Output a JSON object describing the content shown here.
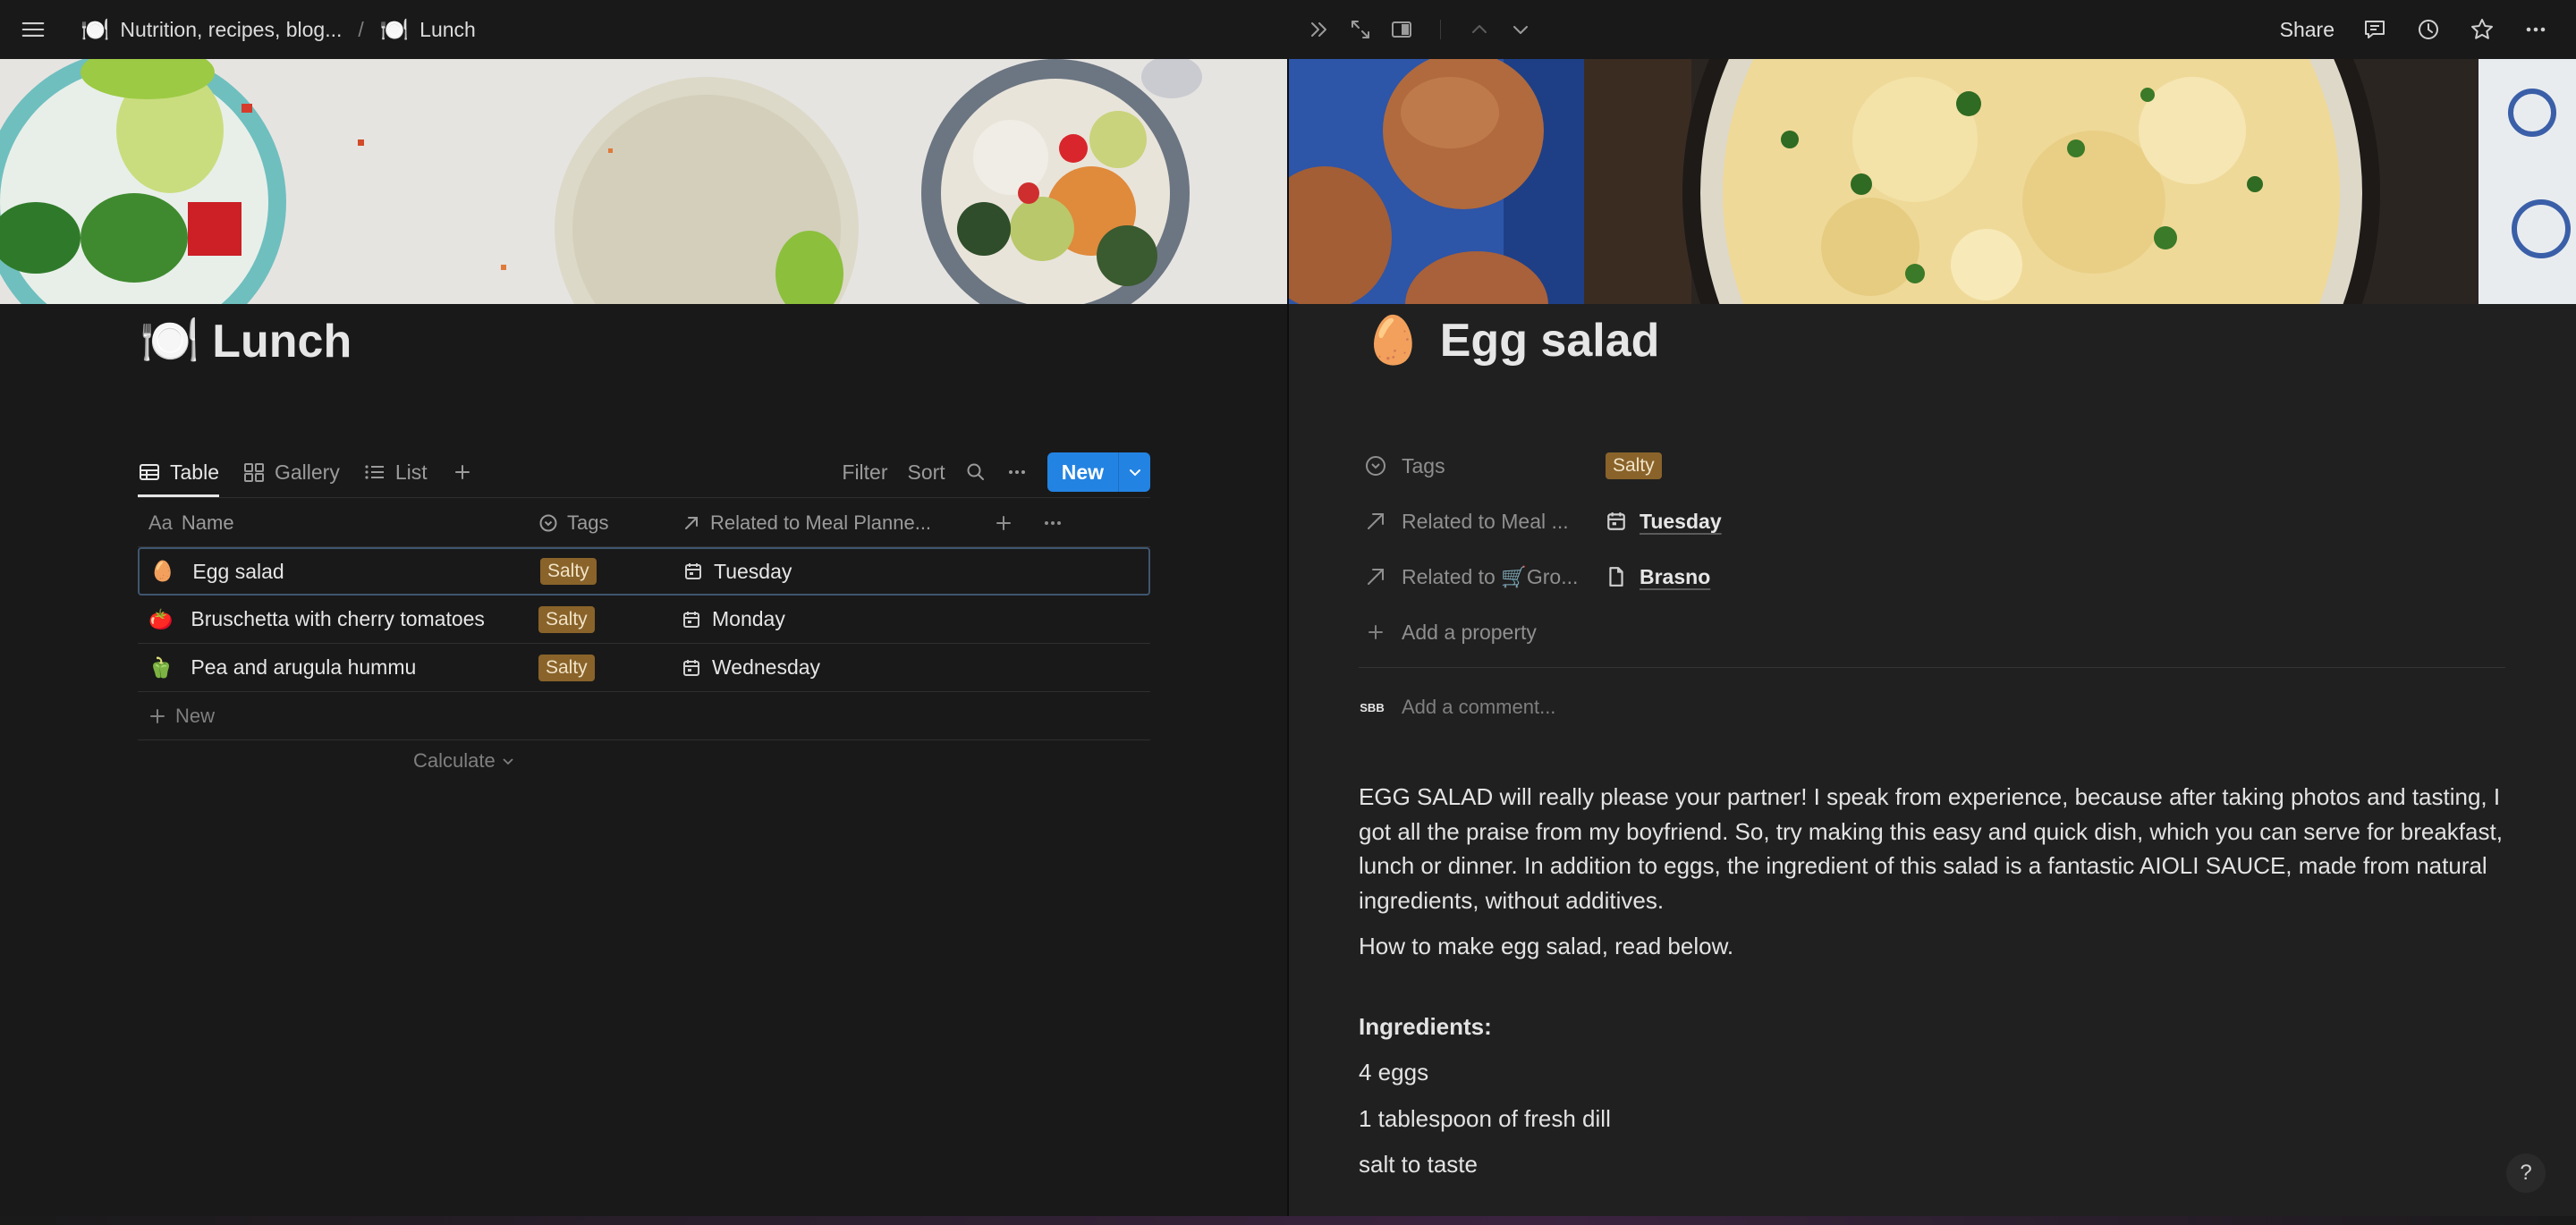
{
  "topbar": {
    "breadcrumb_parent": "Nutrition, recipes, blog...",
    "breadcrumb_current": "Lunch",
    "breadcrumb_parent_emoji": "🍽️",
    "breadcrumb_current_emoji": "🍽️",
    "separator": "/",
    "share_label": "Share",
    "icons": [
      "menu-icon",
      "collapse-panel-icon",
      "expand-icon",
      "side-peek-icon",
      "chevron-up-icon",
      "chevron-down-icon",
      "comments-icon",
      "history-icon",
      "star-icon",
      "more-icon"
    ]
  },
  "left": {
    "title_emoji": "🍽️",
    "title": "Lunch",
    "tabs": [
      {
        "label": "Table",
        "icon": "table-icon"
      },
      {
        "label": "Gallery",
        "icon": "gallery-icon"
      },
      {
        "label": "List",
        "icon": "list-icon"
      }
    ],
    "actions": {
      "filter": "Filter",
      "sort": "Sort",
      "new": "New"
    },
    "columns": {
      "name": "Name",
      "name_prefix": "Aa",
      "tags": "Tags",
      "related": "Related to Meal Planne..."
    },
    "rows": [
      {
        "emoji": "🥚",
        "name": "Egg salad",
        "tag": "Salty",
        "related": "Tuesday"
      },
      {
        "emoji": "🍅",
        "name": "Bruschetta with cherry tomatoes",
        "tag": "Salty",
        "related": "Monday"
      },
      {
        "emoji": "🫑",
        "name": "Pea and arugula hummu",
        "tag": "Salty",
        "related": "Wednesday"
      }
    ],
    "new_row": "New",
    "calculate": "Calculate"
  },
  "right": {
    "title_emoji": "🥚",
    "title": "Egg salad",
    "properties": [
      {
        "key": "Tags",
        "value": "Salty",
        "kind": "tag"
      },
      {
        "key": "Related to Meal ...",
        "value": "Tuesday",
        "kind": "relation-calendar"
      },
      {
        "key": "Related to 🛒Gro...",
        "value": "Brasno",
        "kind": "relation-page"
      }
    ],
    "add_property": "Add a property",
    "comment_avatar": "SBB",
    "comment_placeholder": "Add a comment...",
    "paragraphs": [
      "EGG SALAD will really please your partner! I speak from experience, because after taking photos and tasting, I got all the praise from my boyfriend. So, try making this easy and quick dish, which you can serve for breakfast, lunch or dinner. In addition to eggs, the ingredient of this salad is a fantastic AIOLI SAUCE, made from natural ingredients, without additives.",
      "How to make egg salad, read below."
    ],
    "ingredients_heading": "Ingredients:",
    "ingredients": [
      "4 eggs",
      "1 tablespoon of fresh dill",
      "salt to taste"
    ]
  },
  "help_label": "?",
  "colors": {
    "accent": "#2383e2",
    "tag_bg": "#89632a",
    "bg_left": "#191919",
    "bg_right": "#202020"
  }
}
